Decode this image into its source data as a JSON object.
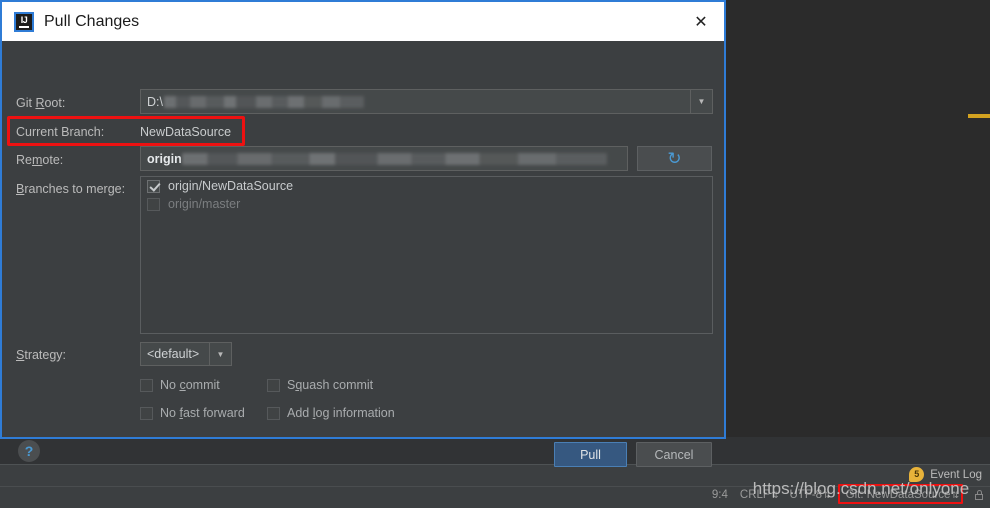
{
  "window": {
    "background_color": "#2b2b2b",
    "dialog_border_color": "#2f7cd6",
    "accent_color": "#365880",
    "annotation_color": "#ee1111"
  },
  "dialog": {
    "app_icon": "intellij-idea-icon",
    "app_icon_letters": "IJ",
    "title": "Pull Changes",
    "close_label": "✕",
    "fields": {
      "git_root": {
        "label_pre": "Git ",
        "label_mnemonic": "R",
        "label_post": "oot:",
        "value_prefix": "D:\\",
        "value_redacted": true,
        "dropdown_arrow": "▼"
      },
      "current_branch": {
        "label": "Current Branch:",
        "value": "NewDataSource",
        "highlighted": true
      },
      "remote": {
        "label_pre": "Re",
        "label_mnemonic": "m",
        "label_post": "ote:",
        "value_prefix": "origin",
        "value_redacted": true,
        "refresh_icon": "refresh-icon",
        "refresh_glyph": "↻"
      },
      "branches_to_merge": {
        "label_mnemonic": "B",
        "label_post": "ranches to merge:",
        "items": [
          {
            "label": "origin/NewDataSource",
            "checked": true,
            "enabled": true
          },
          {
            "label": "origin/master",
            "checked": false,
            "enabled": false
          }
        ]
      },
      "strategy": {
        "label_mnemonic": "S",
        "label_post": "trategy:",
        "value": "<default>",
        "dropdown_arrow": "▼",
        "options": [
          "<default>"
        ]
      }
    },
    "options": [
      {
        "pre": "No ",
        "mnemonic": "c",
        "post": "ommit",
        "checked": false
      },
      {
        "pre": "S",
        "mnemonic": "q",
        "post": "uash commit",
        "checked": false
      },
      {
        "pre": "No ",
        "mnemonic": "f",
        "post": "ast forward",
        "checked": false
      },
      {
        "pre": "Add ",
        "mnemonic": "l",
        "post": "og information",
        "checked": false
      }
    ],
    "help_icon": "help-icon",
    "help_glyph": "?",
    "buttons": {
      "primary": "Pull",
      "secondary": "Cancel"
    }
  },
  "status_bar": {
    "event_log": {
      "count": "5",
      "label": "Event Log",
      "icon": "notification-bubble-icon"
    },
    "caret_position": "9:4",
    "line_separator": "CRLF",
    "encoding": "UTF-8",
    "git_branch": "Git: NewDataSource",
    "arrows_glyph": "⇅",
    "lock_icon": "lock-icon",
    "git_highlighted": true
  },
  "watermark": {
    "text": "https://blog.csdn.net/onlyone"
  }
}
